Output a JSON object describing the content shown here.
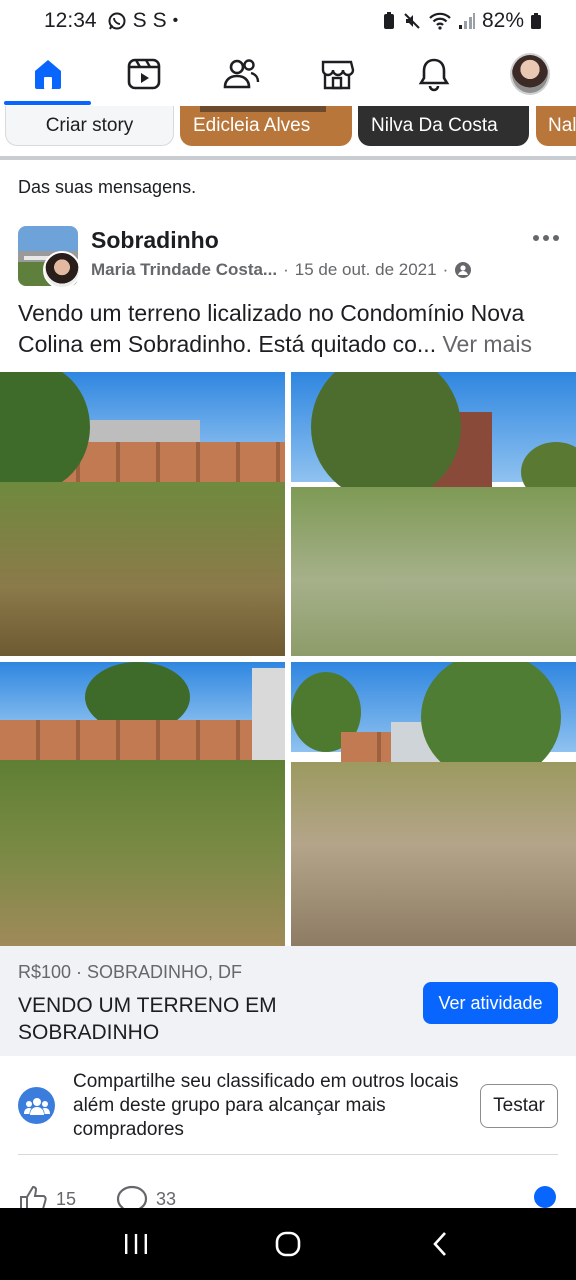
{
  "status_bar": {
    "time": "12:34",
    "notifications": [
      "whatsapp-icon",
      "S",
      "S",
      "•"
    ],
    "battery": "82%"
  },
  "nav": {
    "items": [
      "home-icon",
      "video-icon",
      "friends-icon",
      "marketplace-icon",
      "bell-icon",
      "profile-avatar"
    ],
    "active": "home-icon",
    "accent": "#0866ff"
  },
  "stories": {
    "create_label": "Criar story",
    "items": [
      "Edicleia Alves",
      "Nilva Da Costa",
      "Nal"
    ]
  },
  "post": {
    "origin": "Das suas mensagens.",
    "group_name": "Sobradinho",
    "author": "Maria Trindade Costa...",
    "date": "15 de out. de 2021",
    "text": "Vendo um terreno licalizado no Condomínio Nova Colina em Sobradinho. Está quitado co...",
    "see_more": "Ver mais"
  },
  "listing": {
    "price": "R$100 · SOBRADINHO, DF",
    "title": "VENDO UM TERRENO EM SOBRADINHO",
    "action_label": "Ver atividade"
  },
  "share_notice": {
    "text": "Compartilhe seu classificado em outros locais além deste grupo para alcançar mais compradores",
    "button_label": "Testar"
  },
  "reactions": {
    "likes": "15",
    "comments": "33"
  }
}
